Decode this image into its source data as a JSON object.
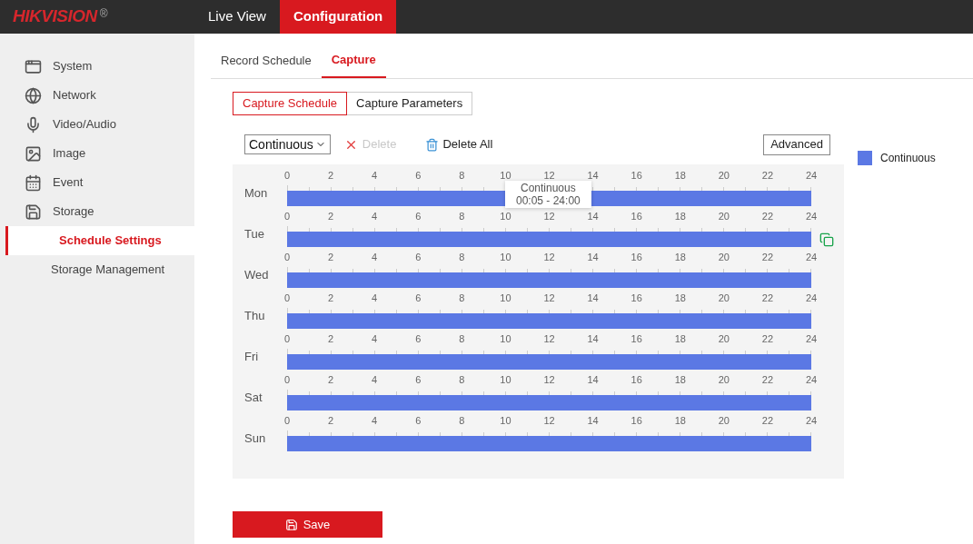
{
  "header": {
    "logo": "HIKVISION",
    "logo_mark": "®",
    "nav": [
      {
        "label": "Live View",
        "selected": false
      },
      {
        "label": "Configuration",
        "selected": true
      }
    ]
  },
  "sidebar": {
    "items": [
      {
        "kind": "section",
        "label": "System"
      },
      {
        "kind": "section",
        "label": "Network"
      },
      {
        "kind": "section",
        "label": "Video/Audio"
      },
      {
        "kind": "section",
        "label": "Image"
      },
      {
        "kind": "section",
        "label": "Event"
      },
      {
        "kind": "section",
        "label": "Storage"
      },
      {
        "kind": "sub",
        "label": "Schedule Settings",
        "selected": true
      },
      {
        "kind": "sub",
        "label": "Storage Management",
        "selected": false
      }
    ]
  },
  "tabs": [
    {
      "label": "Record Schedule",
      "selected": false
    },
    {
      "label": "Capture",
      "selected": true
    }
  ],
  "subtabs": [
    {
      "label": "Capture Schedule",
      "selected": true
    },
    {
      "label": "Capture Parameters",
      "selected": false
    }
  ],
  "toolbar": {
    "mode": "Continuous",
    "delete": {
      "label": "Delete",
      "disabled": true
    },
    "delete_all": {
      "label": "Delete All",
      "disabled": false
    },
    "advanced": "Advanced"
  },
  "days": [
    {
      "label": "Mon",
      "ticks": [
        "0",
        "2",
        "4",
        "6",
        "8",
        "10",
        "12",
        "14",
        "16",
        "18",
        "20",
        "22",
        "24"
      ],
      "copy_shown": false,
      "tooltip": {
        "title": "Continuous",
        "range": "00:05 - 24:00"
      }
    },
    {
      "label": "Tue",
      "ticks": [
        "0",
        "2",
        "4",
        "6",
        "8",
        "10",
        "12",
        "14",
        "16",
        "18",
        "20",
        "22",
        "24"
      ],
      "copy_shown": true
    },
    {
      "label": "Wed",
      "ticks": [
        "0",
        "2",
        "4",
        "6",
        "8",
        "10",
        "12",
        "14",
        "16",
        "18",
        "20",
        "22",
        "24"
      ],
      "copy_shown": false
    },
    {
      "label": "Thu",
      "ticks": [
        "0",
        "2",
        "4",
        "6",
        "8",
        "10",
        "12",
        "14",
        "16",
        "18",
        "20",
        "22",
        "24"
      ],
      "copy_shown": false
    },
    {
      "label": "Fri",
      "ticks": [
        "0",
        "2",
        "4",
        "6",
        "8",
        "10",
        "12",
        "14",
        "16",
        "18",
        "20",
        "22",
        "24"
      ],
      "copy_shown": false
    },
    {
      "label": "Sat",
      "ticks": [
        "0",
        "2",
        "4",
        "6",
        "8",
        "10",
        "12",
        "14",
        "16",
        "18",
        "20",
        "22",
        "24"
      ],
      "copy_shown": false
    },
    {
      "label": "Sun",
      "ticks": [
        "0",
        "2",
        "4",
        "6",
        "8",
        "10",
        "12",
        "14",
        "16",
        "18",
        "20",
        "22",
        "24"
      ],
      "copy_shown": false
    }
  ],
  "legend": [
    {
      "label": "Continuous",
      "color": "#5b78e4"
    }
  ],
  "save": "Save"
}
